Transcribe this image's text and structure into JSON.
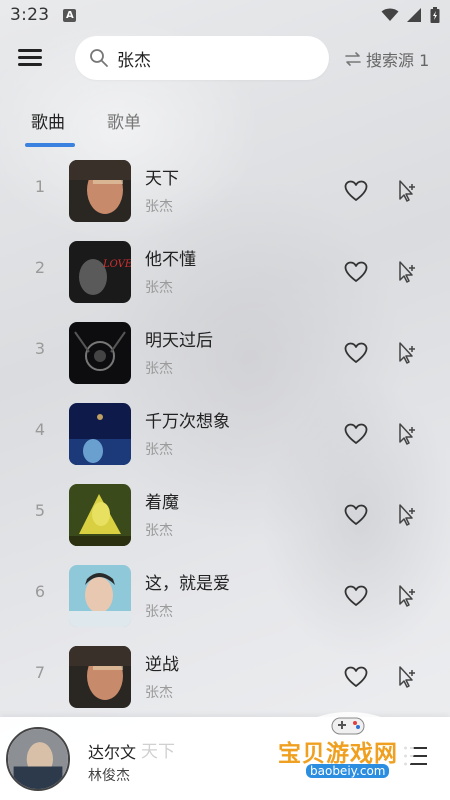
{
  "status": {
    "time": "3:23",
    "notification_badge": "A"
  },
  "search": {
    "value": "张杰",
    "source_label": "搜索源 1"
  },
  "tabs": [
    {
      "label": "歌曲",
      "active": true
    },
    {
      "label": "歌单",
      "active": false
    }
  ],
  "songs": [
    {
      "index": "1",
      "title": "天下",
      "artist": "张杰"
    },
    {
      "index": "2",
      "title": "他不懂",
      "artist": "张杰"
    },
    {
      "index": "3",
      "title": "明天过后",
      "artist": "张杰"
    },
    {
      "index": "4",
      "title": "千万次想象",
      "artist": "张杰"
    },
    {
      "index": "5",
      "title": "着魔",
      "artist": "张杰"
    },
    {
      "index": "6",
      "title": "这，就是爱",
      "artist": "张杰"
    },
    {
      "index": "7",
      "title": "逆战",
      "artist": "张杰"
    }
  ],
  "player": {
    "title": "达尔文",
    "artist": "林俊杰",
    "behind_text": "天下"
  },
  "watermark": {
    "text": "宝贝游戏网",
    "url": "baobeiy.com"
  },
  "colors": {
    "accent": "#3b82e0",
    "secondary_text": "#9a9a9a",
    "watermark": "#f0a020"
  },
  "icons": [
    "menu-icon",
    "search-icon",
    "swap-icon",
    "heart-icon",
    "add-to-playlist-icon",
    "playlist-icon",
    "wifi-icon",
    "signal-icon",
    "battery-icon"
  ]
}
